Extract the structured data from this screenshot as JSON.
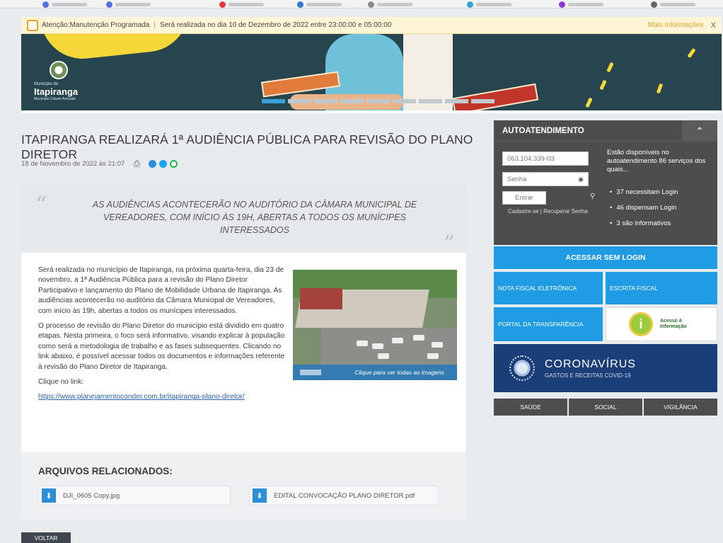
{
  "alert": {
    "label": "Atenção:Manutenção Programada",
    "message": "Será realizada no dia 10 de Dezembro de 2022 entre 23:00:00 e 05:00:00",
    "more": "Mais Informações",
    "close": "X"
  },
  "banner": {
    "logo_small": "Município de",
    "logo_name": "Itapiranga",
    "logo_tagline": "Município Cidade Amizade"
  },
  "article": {
    "title": "ITAPIRANGA REALIZARÁ 1ª AUDIÊNCIA PÚBLICA PARA REVISÃO DO PLANO DIRETOR",
    "date": "18 de Novembro de 2022 às 21:07",
    "quote": "AS AUDIÊNCIAS ACONTECERÃO NO AUDITÓRIO DA CÂMARA MUNICIPAL DE VEREADORES, COM INÍCIO ÀS 19H, ABERTAS A TODOS OS MUNÍCIPES INTERESSADOS",
    "paragraph1": "Será realizada no município de Itapiranga, na próxima quarta-feira, dia 23 de novembro, a 1ª Audiência Pública para a revisão do Plano Diretor Participativo e lançamento do Plano de Mobilidade Urbana de Itapiranga. As audiências acontecerão no auditório da Câmara Municipal de Vereadores, com início às 19h, abertas a todos os munícipes interessados.",
    "paragraph2": "O processo de revisão do Plano Diretor do município está dividido em quatro etapas. Nesta primeira, o foco será informativo, visando explicar à população como será a metodologia de trabalho e as fases subsequentes. Clicando no link abaixo, é possível acessar todos os documentos e informações referente à revisão do Plano Diretor de Itapiranga.",
    "link_intro": "Clique no link:",
    "link": "https://www.planejamentoconder.com.br/itapiranga-plano-diretor/",
    "photo_caption": "Clique para ver todas as imagens"
  },
  "files": {
    "title": "ARQUIVOS RELACIONADOS:",
    "items": [
      "DJI_0605 Copy.jpg",
      "EDITAL CONVOCAÇÃO PLANO DIRETOR.pdf"
    ]
  },
  "back_label": "VOLTAR",
  "sidebar": {
    "auto_title": "AUTOATENDIMENTO",
    "cpf_value": "063.104.339-03",
    "password_placeholder": "Senha",
    "enter_label": "Entrar",
    "register": "Cadastre-se | Recuperar Senha",
    "info": "Estão disponíveis no autoatendimento 86 serviços dos quais...",
    "list": [
      "37 necessitam Login",
      "46 dispensam Login",
      "3 são informativos"
    ],
    "acessar": "ACESSAR SEM LOGIN",
    "tiles": [
      "NOTA FISCAL ELETRÔNICA",
      "ESCRITA FISCAL",
      "PORTAL DA TRANSPARÊNCIA"
    ],
    "acesso_info": "Acesso à Informação",
    "corona_title": "CORONAVÍRUS",
    "corona_sub": "GASTOS E RECEITAS COVID-19",
    "categories": [
      "SAÚDE",
      "SOCIAL",
      "VIGILÂNCIA"
    ]
  },
  "colors": {
    "accent": "#1f9ce4",
    "dark_panel": "#4d4d4d",
    "corona": "#1b3e79",
    "alert_bg": "#fdf5d6"
  }
}
